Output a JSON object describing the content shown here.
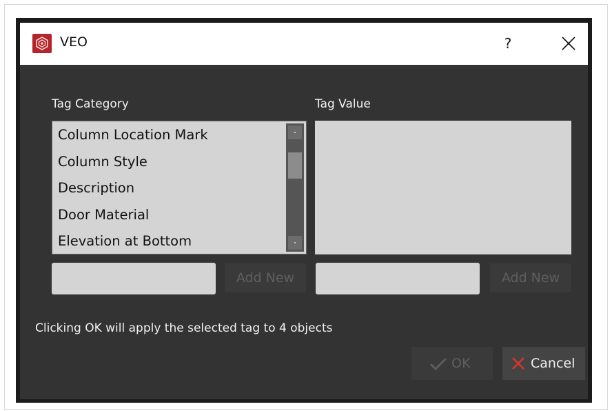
{
  "window": {
    "title": "VEO",
    "help_label": "?",
    "icons": {
      "app": "veo-logo-icon",
      "close": "close-icon"
    },
    "colors": {
      "app_icon_bg": "#b5242a",
      "dialog_bg": "#333333",
      "cancel_x": "#d9342b",
      "ok_check": "#6a6a6a"
    }
  },
  "tag_category": {
    "label": "Tag Category",
    "items": [
      "Column Location Mark",
      "Column Style",
      "Description",
      "Door Material",
      "Elevation at Bottom"
    ],
    "input_value": "",
    "add_label": "Add New"
  },
  "tag_value": {
    "label": "Tag Value",
    "items": [],
    "input_value": "",
    "add_label": "Add New"
  },
  "info": "Clicking OK will apply the selected tag to 4 objects",
  "buttons": {
    "ok": "OK",
    "cancel": "Cancel",
    "ok_icon": "check-icon",
    "cancel_icon": "x-icon"
  }
}
